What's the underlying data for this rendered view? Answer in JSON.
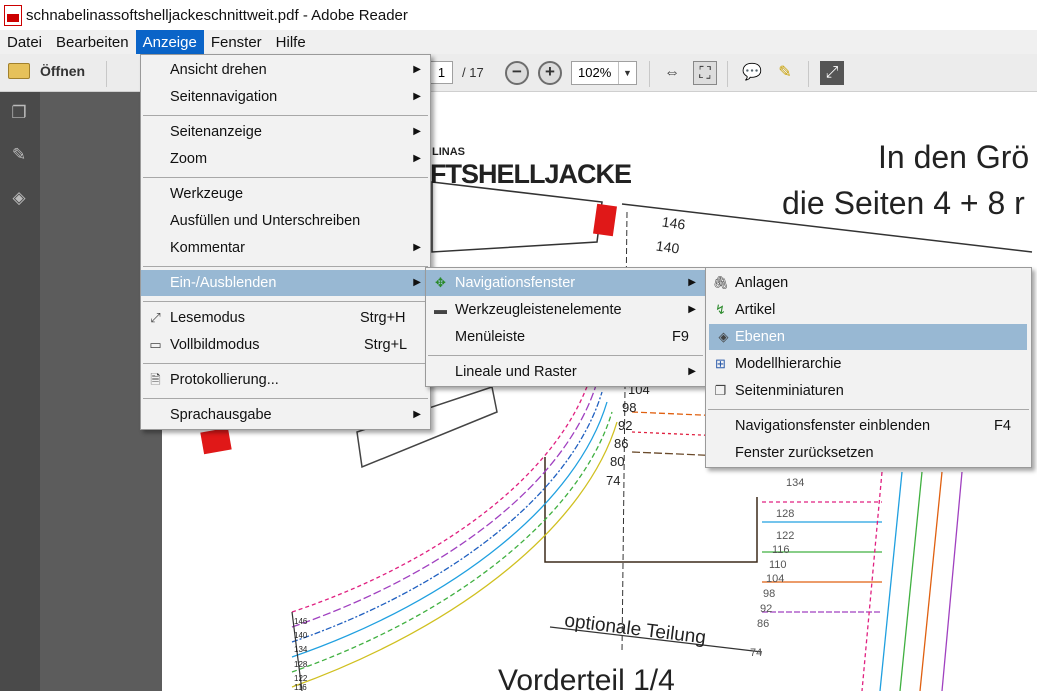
{
  "window": {
    "title": "schnabelinassoftshelljackeschnittweit.pdf - Adobe Reader"
  },
  "menubar": {
    "items": [
      "Datei",
      "Bearbeiten",
      "Anzeige",
      "Fenster",
      "Hilfe"
    ],
    "active": "Anzeige"
  },
  "toolbar": {
    "open_label": "Öffnen",
    "page_current": "1",
    "page_total": "/ 17",
    "zoom": "102%"
  },
  "menu_anzeige": {
    "items": [
      "Ansicht drehen",
      "Seitennavigation",
      "Seitenanzeige",
      "Zoom",
      "Werkzeuge",
      "Ausfüllen und Unterschreiben",
      "Kommentar",
      "Ein-/Ausblenden",
      "Lesemodus",
      "Vollbildmodus",
      "Protokollierung...",
      "Sprachausgabe"
    ],
    "shortcuts": {
      "lesemodus": "Strg+H",
      "vollbild": "Strg+L"
    }
  },
  "menu_einausblenden": {
    "items": [
      "Navigationsfenster",
      "Werkzeugleistenelemente",
      "Menüleiste",
      "Lineale und Raster"
    ],
    "shortcuts": {
      "menueleiste": "F9"
    }
  },
  "menu_navigationsfenster": {
    "items": [
      "Anlagen",
      "Artikel",
      "Ebenen",
      "Modellhierarchie",
      "Seitenminiaturen",
      "Navigationsfenster einblenden",
      "Fenster zurücksetzen"
    ],
    "shortcuts": {
      "einblenden": "F4"
    }
  },
  "document": {
    "brand_top": "LINAS",
    "brand": "FTSHELLJACKE",
    "heading_line1": "In den Grö",
    "heading_line2": "die Seiten 4 + 8 r",
    "sizes_top": [
      "146",
      "140"
    ],
    "sizes_mid": [
      "104",
      "98",
      "92",
      "86",
      "80",
      "74"
    ],
    "sizes_right": [
      "134",
      "128",
      "122",
      "116",
      "110",
      "104",
      "98",
      "92",
      "86",
      "74"
    ],
    "sizes_left": [
      "146",
      "140",
      "134",
      "128",
      "122",
      "116"
    ],
    "optional_label": "optionale Teilung",
    "part_label": "Vorderteil 1/4"
  },
  "colors": {
    "menu_highlight": "#98b8d3",
    "menubar_active": "#0a64c8",
    "sidebar": "#4a4a4a",
    "gutter": "#5c5c5c"
  }
}
